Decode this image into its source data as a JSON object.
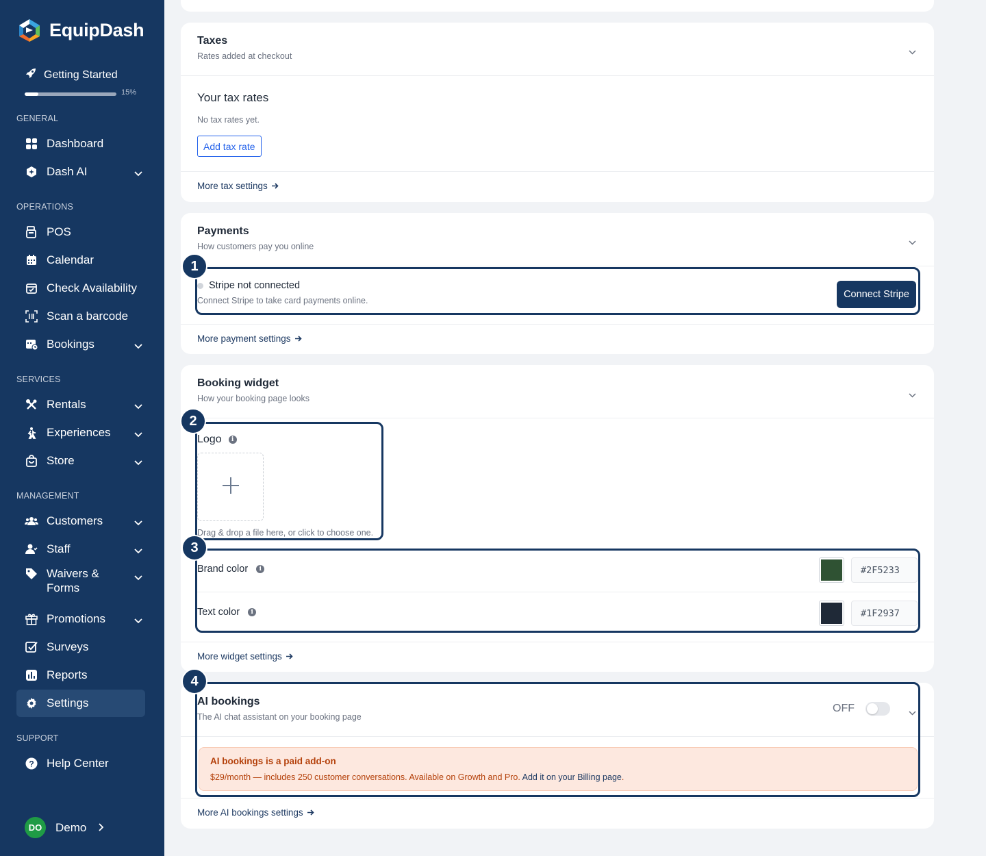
{
  "brand": {
    "name": "EquipDash"
  },
  "getting_started": {
    "label": "Getting Started",
    "percent_text": "15%",
    "progress": 0.15
  },
  "sidebar": {
    "sections": {
      "general": "GENERAL",
      "operations": "OPERATIONS",
      "services": "SERVICES",
      "management": "MANAGEMENT",
      "support": "SUPPORT"
    },
    "items": {
      "dashboard": "Dashboard",
      "dash_ai": "Dash AI",
      "pos": "POS",
      "calendar": "Calendar",
      "check_availability": "Check Availability",
      "scan_barcode": "Scan a barcode",
      "bookings": "Bookings",
      "rentals": "Rentals",
      "experiences": "Experiences",
      "store": "Store",
      "customers": "Customers",
      "staff": "Staff",
      "waivers_line1": "Waivers &",
      "waivers_line2": "Forms",
      "promotions": "Promotions",
      "surveys": "Surveys",
      "reports": "Reports",
      "settings": "Settings",
      "help_center": "Help Center"
    },
    "user": {
      "initials": "DO",
      "name": "Demo"
    }
  },
  "taxes": {
    "title": "Taxes",
    "subtitle": "Rates added at checkout",
    "rates_title": "Your tax rates",
    "empty": "No tax rates yet.",
    "add_button": "Add tax rate",
    "more_link": "More tax settings"
  },
  "payments": {
    "title": "Payments",
    "subtitle": "How customers pay you online",
    "status": "Stripe not connected",
    "description": "Connect Stripe to take card payments online.",
    "connect_button": "Connect Stripe",
    "more_link": "More payment settings"
  },
  "widget": {
    "title": "Booking widget",
    "subtitle": "How your booking page looks",
    "logo_label": "Logo",
    "drop_hint": "Drag & drop a file here, or click to choose one.",
    "brand_color_label": "Brand color",
    "brand_color": "#2F5233",
    "text_color_label": "Text color",
    "text_color": "#1F2937",
    "more_link": "More widget settings"
  },
  "ai": {
    "title": "AI bookings",
    "subtitle": "The AI chat assistant on your booking page",
    "toggle_state": "OFF",
    "enabled": false,
    "alert_title": "AI bookings is a paid add-on",
    "alert_body": "$29/month — includes 250 customer conversations. Available on Growth and Pro.",
    "alert_link": "Add it on your Billing page",
    "alert_end": ".",
    "more_link": "More AI bookings settings"
  },
  "annotations": [
    "1",
    "2",
    "3",
    "4"
  ],
  "colors": {
    "sidebar": "#163761",
    "accent_link": "#2563eb",
    "alert_bg": "#fde8df",
    "alert_text": "#b4400a"
  }
}
